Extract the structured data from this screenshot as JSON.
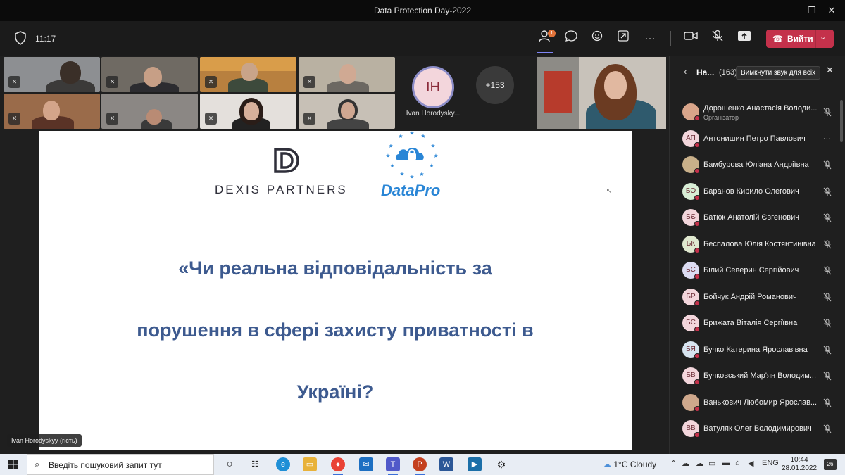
{
  "window": {
    "title": "Data Protection Day-2022",
    "minimize": "—",
    "maximize": "❐",
    "close": "✕"
  },
  "toolbar": {
    "timer": "11:17",
    "participants_badge": "1",
    "leave_label": "Вийти"
  },
  "stage": {
    "more_count": "+153",
    "guest_initials": "IH",
    "guest_name": "Ivan Horodysky...",
    "sharer_label": "Ivan Horodyskyy (гість)"
  },
  "slide": {
    "dexis_label": "DEXIS PARTNERS",
    "datapro_label": "DataPro",
    "line1": "«Чи реальна відповідальність за",
    "line2": "порушення в сфері захисту приватності в",
    "line3": "Україні?"
  },
  "panel": {
    "title": "На...",
    "count": "(163)",
    "mute_all": "Вимкнути звук для всіх",
    "participants": [
      {
        "initials": "",
        "name": "Дорошенко Анастасія Володи...",
        "role": "Організатор",
        "color": "#d9a58a",
        "photo": true
      },
      {
        "initials": "АП",
        "name": "Антонишин Петро Павлович",
        "role": "",
        "color": "#f3d6dc",
        "photo": false,
        "menu": "···"
      },
      {
        "initials": "",
        "name": "Бамбурова Юліана Андріївна",
        "role": "",
        "color": "#c9b08a",
        "photo": true
      },
      {
        "initials": "БО",
        "name": "Баранов Кирило Олегович",
        "role": "",
        "color": "#d8eed6",
        "photo": false
      },
      {
        "initials": "БЄ",
        "name": "Батюк Анатолій Євгенович",
        "role": "",
        "color": "#f3d6dc",
        "photo": false
      },
      {
        "initials": "БК",
        "name": "Беспалова Юлія Костянтинівна",
        "role": "",
        "color": "#dfe8cf",
        "photo": false
      },
      {
        "initials": "БС",
        "name": "Білий Северин Сергійович",
        "role": "",
        "color": "#dcdcf2",
        "photo": false
      },
      {
        "initials": "БР",
        "name": "Бойчук Андрій Романович",
        "role": "",
        "color": "#f3d6dc",
        "photo": false
      },
      {
        "initials": "БС",
        "name": "Брижата Віталія Сергіївна",
        "role": "",
        "color": "#f3d6dc",
        "photo": false
      },
      {
        "initials": "БЯ",
        "name": "Бучко Катерина Ярославівна",
        "role": "",
        "color": "#d7e4f0",
        "photo": false
      },
      {
        "initials": "БВ",
        "name": "Бучковський Мар'ян Володим...",
        "role": "",
        "color": "#f3d6dc",
        "photo": false
      },
      {
        "initials": "",
        "name": "Ванькович Любомир Ярослав...",
        "role": "",
        "color": "#cfa88c",
        "photo": true
      },
      {
        "initials": "ВВ",
        "name": "Ватуляк Олег Володимирович",
        "role": "",
        "color": "#f3d6dc",
        "photo": false
      }
    ]
  },
  "taskbar": {
    "search_placeholder": "Введіть пошуковий запит тут",
    "weather": "1°C  Cloudy",
    "language": "ENG",
    "time": "10:44",
    "date": "28.01.2022",
    "notifications": "26"
  }
}
